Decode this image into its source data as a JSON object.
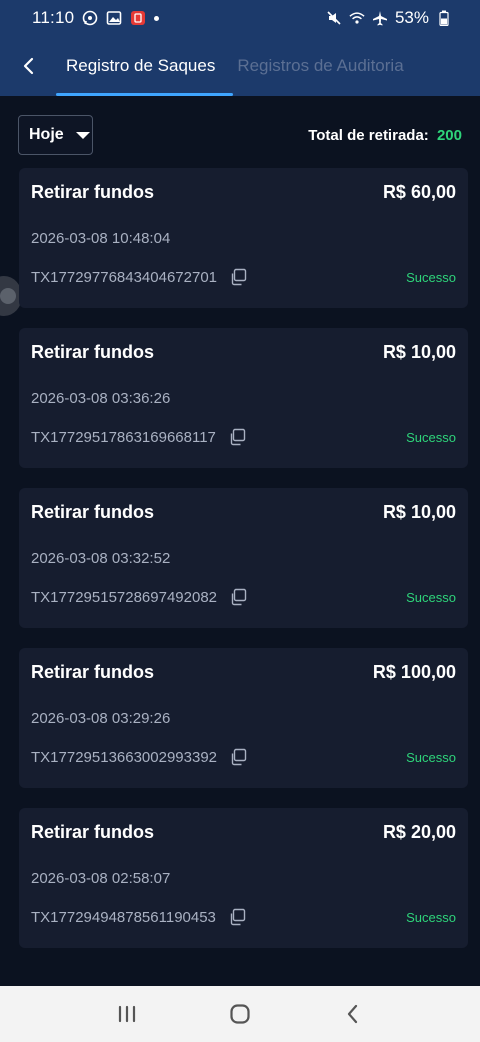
{
  "status_bar": {
    "time": "11:10",
    "battery": "53%",
    "icons_left": [
      "whatsapp-icon",
      "gallery-icon",
      "app-notification-icon",
      "dot"
    ],
    "icons_right": [
      "mute-icon",
      "wifi-icon",
      "airplane-icon",
      "battery-icon"
    ]
  },
  "header": {
    "tabs": [
      {
        "label": "Registro de Saques",
        "active": true
      },
      {
        "label": "Registros de Auditoria",
        "active": false
      }
    ]
  },
  "filter": {
    "date_value": "Hoje",
    "total_label": "Total de retirada:",
    "total_value": "200"
  },
  "records": [
    {
      "title": "Retirar fundos",
      "amount": "R$ 60,00",
      "datetime": "2026-03-08 10:48:04",
      "tx_id": "TX17729776843404672701",
      "status": "Sucesso"
    },
    {
      "title": "Retirar fundos",
      "amount": "R$ 10,00",
      "datetime": "2026-03-08 03:36:26",
      "tx_id": "TX17729517863169668117",
      "status": "Sucesso"
    },
    {
      "title": "Retirar fundos",
      "amount": "R$ 10,00",
      "datetime": "2026-03-08 03:32:52",
      "tx_id": "TX17729515728697492082",
      "status": "Sucesso"
    },
    {
      "title": "Retirar fundos",
      "amount": "R$ 100,00",
      "datetime": "2026-03-08 03:29:26",
      "tx_id": "TX17729513663002993392",
      "status": "Sucesso"
    },
    {
      "title": "Retirar fundos",
      "amount": "R$ 20,00",
      "datetime": "2026-03-08 02:58:07",
      "tx_id": "TX17729494878561190453",
      "status": "Sucesso"
    }
  ],
  "colors": {
    "header_bg": "#1c3a6b",
    "page_bg": "#0b1220",
    "card_bg": "#161d2f",
    "success": "#2ed47a",
    "tab_indicator": "#3fa5ff",
    "inactive_tab": "#5b6f93"
  }
}
